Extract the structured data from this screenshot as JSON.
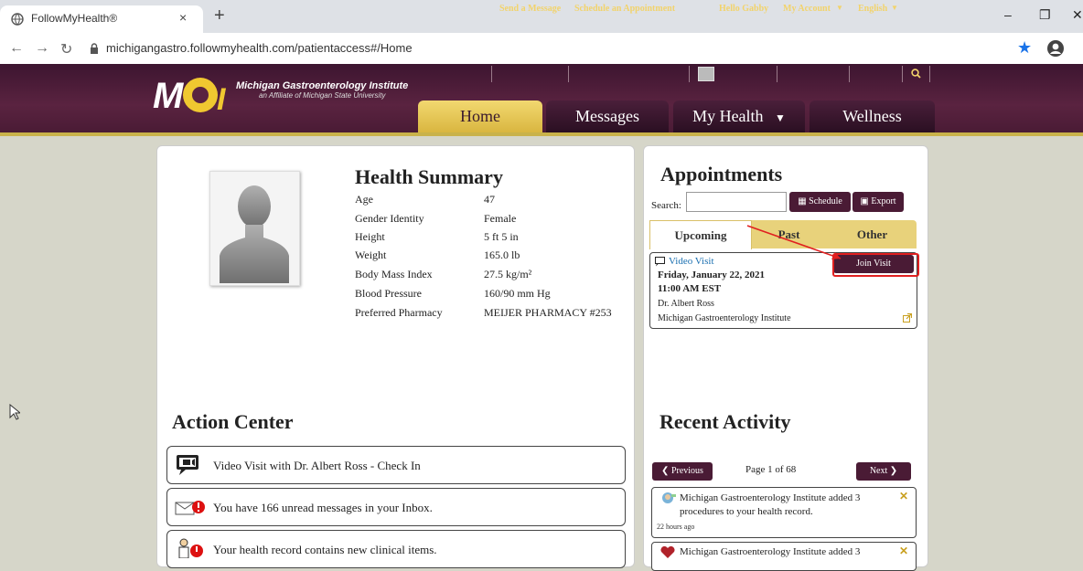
{
  "browser": {
    "tab_title": "FollowMyHealth®",
    "tab_close": "×",
    "new_tab": "+",
    "url": "michigangastro.followmyhealth.com/patientaccess#/Home"
  },
  "header": {
    "logo_name": "Michigan Gastroenterology Institute",
    "logo_sub": "an Affiliate of Michigan State University",
    "links": {
      "send_message": "Send a Message",
      "schedule": "Schedule an Appointment",
      "hello": "Hello Gabby",
      "my_account": "My Account",
      "language": "English"
    },
    "nav": [
      "Home",
      "Messages",
      "My Health",
      "Wellness"
    ]
  },
  "health_summary": {
    "title": "Health Summary",
    "rows": [
      {
        "label": "Age",
        "value": "47"
      },
      {
        "label": "Gender Identity",
        "value": "Female"
      },
      {
        "label": "Height",
        "value": "5 ft 5 in"
      },
      {
        "label": "Weight",
        "value": "165.0 lb"
      },
      {
        "label": "Body Mass Index",
        "value": "27.5 kg/m²"
      },
      {
        "label": "Blood Pressure",
        "value": "160/90 mm Hg"
      },
      {
        "label": "Preferred Pharmacy",
        "value": "MEIJER PHARMACY #253"
      }
    ]
  },
  "action_center": {
    "title": "Action Center",
    "items": [
      "Video Visit with Dr. Albert Ross - Check In",
      "You have 166 unread messages in your Inbox.",
      "Your health record contains new clinical items."
    ]
  },
  "appointments": {
    "title": "Appointments",
    "search_label": "Search:",
    "search_value": "",
    "schedule_btn": "Schedule",
    "export_btn": "Export",
    "tabs": [
      "Upcoming",
      "Past",
      "Other"
    ],
    "card": {
      "type": "Video Visit",
      "date": "Friday, January 22, 2021",
      "time": "11:00 AM EST",
      "doctor": "Dr. Albert Ross",
      "location": "Michigan Gastroenterology Institute",
      "join_btn": "Join Visit"
    }
  },
  "recent_activity": {
    "title": "Recent Activity",
    "prev_btn": "Previous",
    "next_btn": "Next",
    "page": "Page 1 of 68",
    "items": [
      {
        "text": "Michigan Gastroenterology Institute added 3 procedures to your health record.",
        "time": "22 hours ago"
      },
      {
        "text": "Michigan Gastroenterology Institute added 3",
        "time": ""
      }
    ]
  }
}
